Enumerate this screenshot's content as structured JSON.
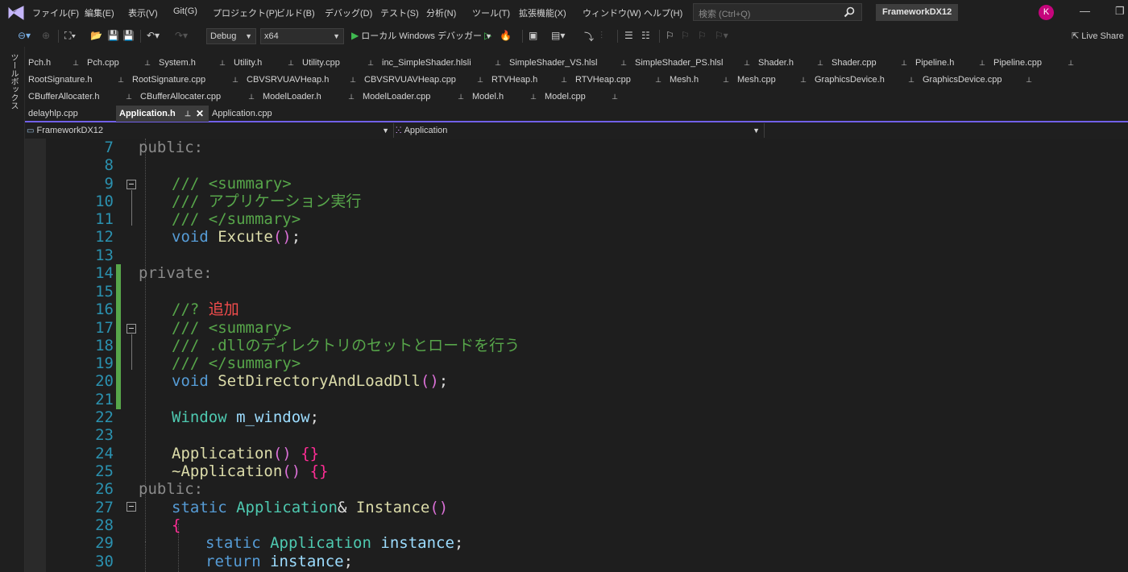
{
  "menu": [
    "ファイル(F)",
    "編集(E)",
    "表示(V)",
    "Git(G)",
    "プロジェクト(P)",
    "ビルド(B)",
    "デバッグ(D)",
    "テスト(S)",
    "分析(N)",
    "ツール(T)",
    "拡張機能(X)",
    "ウィンドウ(W)",
    "ヘルプ(H)"
  ],
  "search": {
    "placeholder": "検索 (Ctrl+Q)"
  },
  "solution_name": "FrameworkDX12",
  "avatar_initial": "K",
  "toolbar": {
    "config": "Debug",
    "platform": "x64",
    "run_label": "ローカル Windows デバッガー",
    "live_share": "Live Share"
  },
  "toolbox_label": "ツールボックス",
  "tabs_row1": [
    "Pch.h",
    "Pch.cpp",
    "System.h",
    "Utility.h",
    "Utility.cpp",
    "inc_SimpleShader.hlsli",
    "SimpleShader_VS.hlsl",
    "SimpleShader_PS.hlsl",
    "Shader.h",
    "Shader.cpp",
    "Pipeline.h",
    "Pipeline.cpp"
  ],
  "tabs_row2": [
    "RootSignature.h",
    "RootSignature.cpp",
    "CBVSRVUAVHeap.h",
    "CBVSRVUAVHeap.cpp",
    "RTVHeap.h",
    "RTVHeap.cpp",
    "Mesh.h",
    "Mesh.cpp",
    "GraphicsDevice.h",
    "GraphicsDevice.cpp"
  ],
  "tabs_row3": [
    "CBufferAllocater.h",
    "CBufferAllocater.cpp",
    "ModelLoader.h",
    "ModelLoader.cpp",
    "Model.h",
    "Model.cpp"
  ],
  "tabs_row4": [
    "delayhlp.cpp",
    "Application.h",
    "Application.cpp"
  ],
  "active_tab": "Application.h",
  "nav": {
    "project": "FrameworkDX12",
    "scope": "Application"
  },
  "code": {
    "ln": [
      "7",
      "8",
      "9",
      "10",
      "11",
      "12",
      "13",
      "14",
      "15",
      "16",
      "17",
      "18",
      "19",
      "20",
      "21",
      "22",
      "23",
      "24",
      "25",
      "26",
      "27",
      "28",
      "29",
      "30"
    ],
    "l7": "public:",
    "l9": "/// <summary>",
    "l10": "/// アプリケーション実行",
    "l11": "/// </summary>",
    "l12_kw": "void",
    "l12_fn": "Excute",
    "l14": "private:",
    "l16_a": "//?",
    "l16_b": "追加",
    "l17": "/// <summary>",
    "l18": "/// .dllのディレクトリのセットとロードを行う",
    "l19": "/// </summary>",
    "l20_kw": "void",
    "l20_fn": "SetDirectoryAndLoadDll",
    "l22_ty": "Window",
    "l22_var": "m_window",
    "l24_fn": "Application",
    "l25_fn": "~Application",
    "l26": "public:",
    "l27_kw": "static",
    "l27_ty": "Application",
    "l27_fn": "Instance",
    "l28": "{",
    "l29_kw": "static",
    "l29_ty": "Application",
    "l29_var": "instance",
    "l30_kw": "return",
    "l30_var": "instance"
  }
}
